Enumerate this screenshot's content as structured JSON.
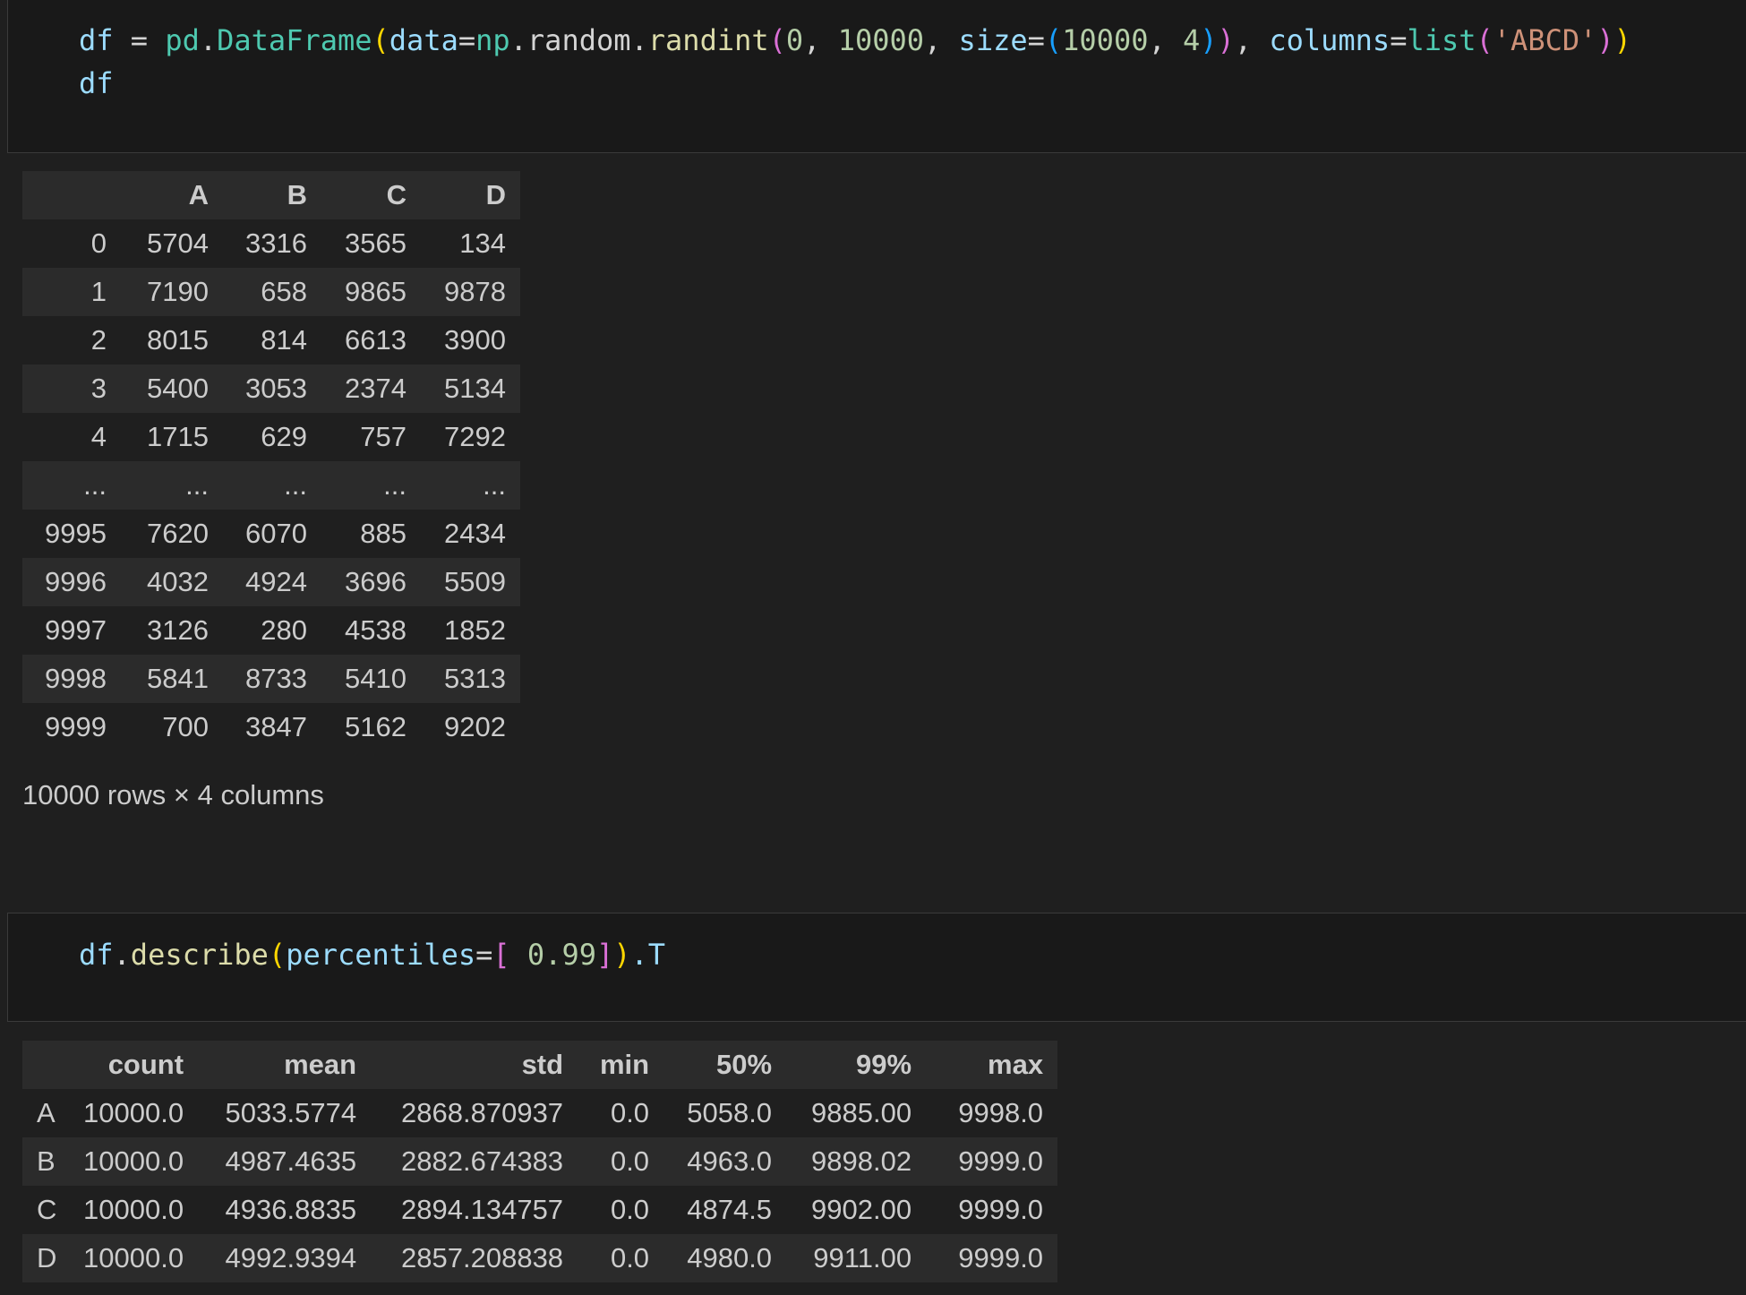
{
  "cell1": {
    "code": {
      "df": "df",
      "eq": " = ",
      "pd": "pd",
      "dot1": ".",
      "DataFrame": "DataFrame",
      "open1": "(",
      "data_kw": "data",
      "eq2": "=",
      "np": "np",
      "dot2": ".random.",
      "randint": "randint",
      "open2": "(",
      "zero": "0",
      "comma1": ", ",
      "tenk1": "10000",
      "comma2": ", ",
      "size_kw": "size",
      "eq3": "=",
      "open3": "(",
      "tenk2": "10000",
      "comma3": ", ",
      "four": "4",
      "close3": ")",
      "close2": ")",
      "comma4": ", ",
      "columns_kw": "columns",
      "eq4": "=",
      "list": "list",
      "open4": "(",
      "abcd": "'ABCD'",
      "close4": ")",
      "close1": ")",
      "line2": "df"
    }
  },
  "output1": {
    "columns": [
      "A",
      "B",
      "C",
      "D"
    ],
    "rows": [
      {
        "index": "0",
        "values": [
          "5704",
          "3316",
          "3565",
          "134"
        ]
      },
      {
        "index": "1",
        "values": [
          "7190",
          "658",
          "9865",
          "9878"
        ]
      },
      {
        "index": "2",
        "values": [
          "8015",
          "814",
          "6613",
          "3900"
        ]
      },
      {
        "index": "3",
        "values": [
          "5400",
          "3053",
          "2374",
          "5134"
        ]
      },
      {
        "index": "4",
        "values": [
          "1715",
          "629",
          "757",
          "7292"
        ]
      },
      {
        "index": "...",
        "values": [
          "...",
          "...",
          "...",
          "..."
        ]
      },
      {
        "index": "9995",
        "values": [
          "7620",
          "6070",
          "885",
          "2434"
        ]
      },
      {
        "index": "9996",
        "values": [
          "4032",
          "4924",
          "3696",
          "5509"
        ]
      },
      {
        "index": "9997",
        "values": [
          "3126",
          "280",
          "4538",
          "1852"
        ]
      },
      {
        "index": "9998",
        "values": [
          "5841",
          "8733",
          "5410",
          "5313"
        ]
      },
      {
        "index": "9999",
        "values": [
          "700",
          "3847",
          "5162",
          "9202"
        ]
      }
    ],
    "shape": "10000 rows × 4 columns"
  },
  "cell2": {
    "code": {
      "df": "df",
      "dot": ".",
      "describe": "describe",
      "open1": "(",
      "kw": "percentiles",
      "eq": "=",
      "open2": "[",
      "space": " ",
      "val": "0.99",
      "close2": "]",
      "close1": ")",
      "tail": ".T"
    }
  },
  "output2": {
    "columns": [
      "count",
      "mean",
      "std",
      "min",
      "50%",
      "99%",
      "max"
    ],
    "rows": [
      {
        "index": "A",
        "values": [
          "10000.0",
          "5033.5774",
          "2868.870937",
          "0.0",
          "5058.0",
          "9885.00",
          "9998.0"
        ]
      },
      {
        "index": "B",
        "values": [
          "10000.0",
          "4987.4635",
          "2882.674383",
          "0.0",
          "4963.0",
          "9898.02",
          "9999.0"
        ]
      },
      {
        "index": "C",
        "values": [
          "10000.0",
          "4936.8835",
          "2894.134757",
          "0.0",
          "4874.5",
          "9902.00",
          "9999.0"
        ]
      },
      {
        "index": "D",
        "values": [
          "10000.0",
          "4992.9394",
          "2857.208838",
          "0.0",
          "4980.0",
          "9911.00",
          "9999.0"
        ]
      }
    ]
  }
}
